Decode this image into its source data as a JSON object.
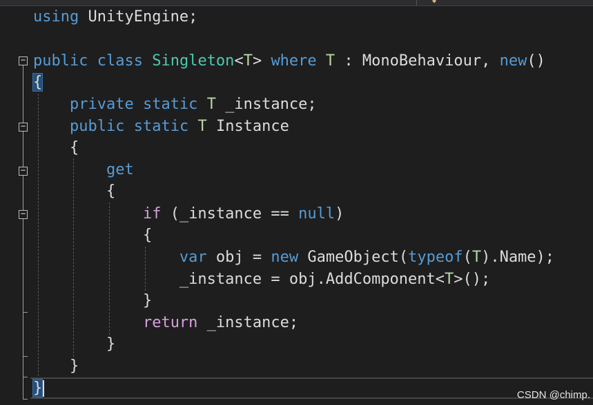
{
  "editor": {
    "lines": [
      {
        "tokens": [
          {
            "t": "using",
            "c": "kw"
          },
          {
            "t": " UnityEngine;"
          }
        ]
      },
      {
        "tokens": []
      },
      {
        "tokens": [
          {
            "t": "public",
            "c": "kw"
          },
          {
            "t": " "
          },
          {
            "t": "class",
            "c": "kw"
          },
          {
            "t": " "
          },
          {
            "t": "Singleton",
            "c": "ty"
          },
          {
            "t": "<"
          },
          {
            "t": "T",
            "c": "tp"
          },
          {
            "t": "> "
          },
          {
            "t": "where",
            "c": "kw"
          },
          {
            "t": " "
          },
          {
            "t": "T",
            "c": "tp"
          },
          {
            "t": " : MonoBehaviour, "
          },
          {
            "t": "new",
            "c": "kw"
          },
          {
            "t": "()"
          }
        ]
      },
      {
        "tokens": [
          {
            "t": "{",
            "c": "hl"
          }
        ]
      },
      {
        "tokens": [
          {
            "t": "    "
          },
          {
            "t": "private",
            "c": "kw"
          },
          {
            "t": " "
          },
          {
            "t": "static",
            "c": "kw"
          },
          {
            "t": " "
          },
          {
            "t": "T",
            "c": "tp"
          },
          {
            "t": " _instance;"
          }
        ]
      },
      {
        "tokens": [
          {
            "t": "    "
          },
          {
            "t": "public",
            "c": "kw"
          },
          {
            "t": " "
          },
          {
            "t": "static",
            "c": "kw"
          },
          {
            "t": " "
          },
          {
            "t": "T",
            "c": "tp"
          },
          {
            "t": " Instance"
          }
        ]
      },
      {
        "tokens": [
          {
            "t": "    {"
          }
        ]
      },
      {
        "tokens": [
          {
            "t": "        "
          },
          {
            "t": "get",
            "c": "kw"
          }
        ]
      },
      {
        "tokens": [
          {
            "t": "        {"
          }
        ]
      },
      {
        "tokens": [
          {
            "t": "            "
          },
          {
            "t": "if",
            "c": "kwc"
          },
          {
            "t": " (_instance == "
          },
          {
            "t": "null",
            "c": "kw"
          },
          {
            "t": ")"
          }
        ]
      },
      {
        "tokens": [
          {
            "t": "            {"
          }
        ]
      },
      {
        "tokens": [
          {
            "t": "                "
          },
          {
            "t": "var",
            "c": "kw"
          },
          {
            "t": " obj = "
          },
          {
            "t": "new",
            "c": "kw"
          },
          {
            "t": " GameObject("
          },
          {
            "t": "typeof",
            "c": "kw"
          },
          {
            "t": "("
          },
          {
            "t": "T",
            "c": "tp"
          },
          {
            "t": ").Name);"
          }
        ]
      },
      {
        "tokens": [
          {
            "t": "                _instance = obj.AddComponent<"
          },
          {
            "t": "T",
            "c": "tp"
          },
          {
            "t": ">();"
          }
        ]
      },
      {
        "tokens": [
          {
            "t": "            }"
          }
        ]
      },
      {
        "tokens": [
          {
            "t": "            "
          },
          {
            "t": "return",
            "c": "kwc"
          },
          {
            "t": " _instance;"
          }
        ]
      },
      {
        "tokens": [
          {
            "t": "        }"
          }
        ]
      },
      {
        "tokens": [
          {
            "t": "    }"
          }
        ]
      },
      {
        "tokens": [
          {
            "t": "}",
            "c": "hl"
          },
          {
            "t": "",
            "c": "caret"
          }
        ]
      }
    ],
    "fold_toggle_symbol": "−"
  },
  "watermark": "CSDN @chimp.",
  "colors": {
    "background": "#1e1e1e",
    "keyword": "#569cd6",
    "control_keyword": "#d8a0df",
    "type": "#4ec9b0",
    "type_param": "#b8d7a3",
    "text": "#dcdcdc",
    "brace_highlight": "#264f78"
  }
}
